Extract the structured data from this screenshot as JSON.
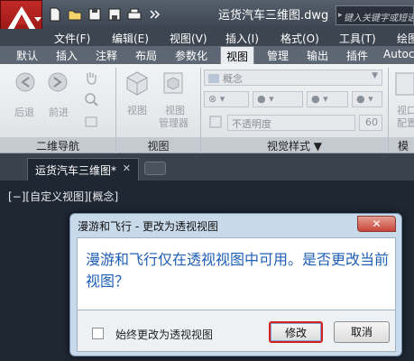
{
  "window": {
    "title": "运货汽车三维图.dwg",
    "search_placeholder": "键入关键字或短语"
  },
  "menu": [
    "文件(F)",
    "编辑(E)",
    "视图(V)",
    "插入(I)",
    "格式(O)",
    "工具(T)",
    "绘图"
  ],
  "ribbon_tabs": [
    "默认",
    "插入",
    "注释",
    "布局",
    "参数化",
    "视图",
    "管理",
    "输出",
    "插件",
    "Autoc"
  ],
  "ribbon_active_tab": "视图",
  "ribbon": {
    "nav_panel": {
      "back": "后退",
      "forward": "前进",
      "footer": "二维导航"
    },
    "view_panel": {
      "view": "视图",
      "view_manager_1": "视图",
      "view_manager_2": "管理器",
      "footer": "视图"
    },
    "visual_style_panel": {
      "style_value": "概念",
      "opacity_label": "不透明度",
      "opacity_value": "60",
      "footer": "视觉样式 ▼"
    },
    "right_panel": {
      "label": "视口",
      "label2": "配置",
      "footer": "模型"
    }
  },
  "doc_tab": {
    "label": "运货汽车三维图*",
    "close": "✕"
  },
  "viewport": {
    "label": "[−][自定义视图][概念]"
  },
  "dialog": {
    "title": "漫游和飞行 - 更改为透视视图",
    "close": "✕",
    "message": "漫游和飞行仅在透视视图中可用。是否更改当前视图？",
    "checkbox_label": "始终更改为透视视图",
    "ok": "修改",
    "cancel": "取消"
  },
  "colors": {
    "app_button": "#c12a26",
    "message_text": "#1f5fb5",
    "highlight_border": "#d61f1f"
  }
}
